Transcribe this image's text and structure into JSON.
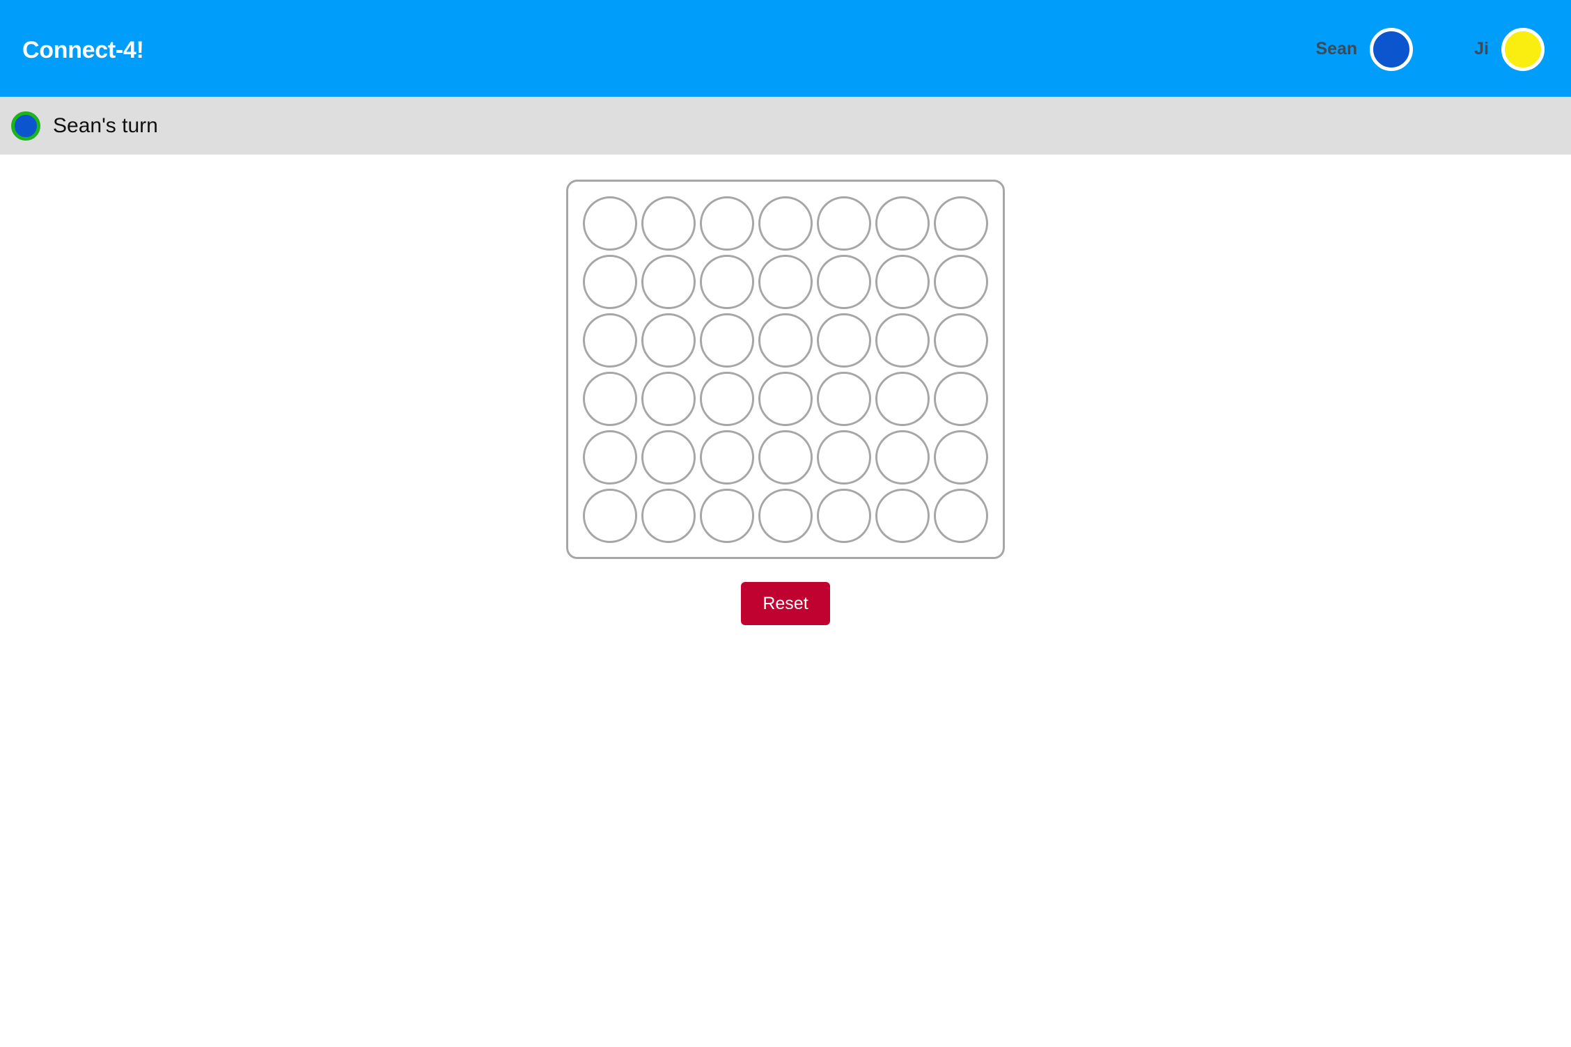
{
  "header": {
    "title": "Connect-4!",
    "background_color": "#009dfa",
    "title_color": "#ffffff",
    "players": [
      {
        "name": "Sean",
        "disc_color": "#0b55ce",
        "disc_icon": "blue-disc-icon"
      },
      {
        "name": "Ji",
        "disc_color": "#faee10",
        "disc_icon": "yellow-disc-icon"
      }
    ]
  },
  "status": {
    "text": "Sean's turn",
    "background_color": "#dedede",
    "indicator_fill": "#0b55ce",
    "indicator_ring": "#1eb41e",
    "indicator_icon": "active-player-disc-icon"
  },
  "board": {
    "columns": 7,
    "rows": 6,
    "border_color": "#a6a6a6",
    "hole_color": "#a6a6a6",
    "cells": [
      [
        "empty",
        "empty",
        "empty",
        "empty",
        "empty",
        "empty",
        "empty"
      ],
      [
        "empty",
        "empty",
        "empty",
        "empty",
        "empty",
        "empty",
        "empty"
      ],
      [
        "empty",
        "empty",
        "empty",
        "empty",
        "empty",
        "empty",
        "empty"
      ],
      [
        "empty",
        "empty",
        "empty",
        "empty",
        "empty",
        "empty",
        "empty"
      ],
      [
        "empty",
        "empty",
        "empty",
        "empty",
        "empty",
        "empty",
        "empty"
      ],
      [
        "empty",
        "empty",
        "empty",
        "empty",
        "empty",
        "empty",
        "empty"
      ]
    ]
  },
  "controls": {
    "reset_label": "Reset",
    "reset_color": "#c00231"
  }
}
